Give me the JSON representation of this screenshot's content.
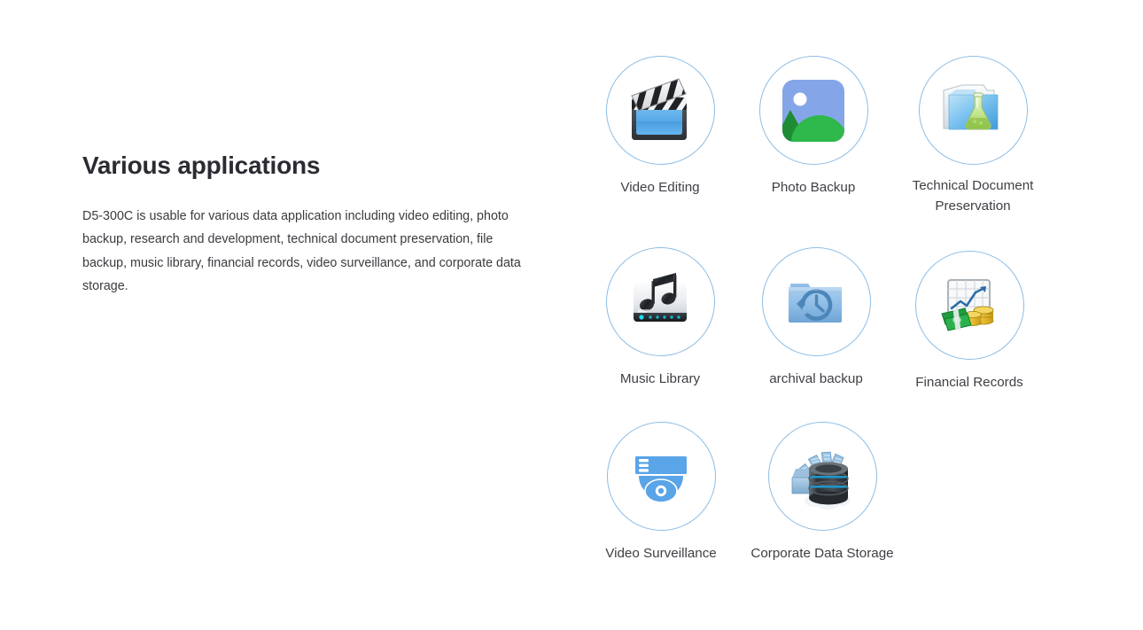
{
  "text_panel": {
    "title": "Various applications",
    "description": "D5-300C is usable for various data application including video editing, photo backup, research and development, technical document preservation, file backup, music library, financial records, video surveillance, and corporate data storage."
  },
  "colors": {
    "circle_border": "#8cbde5",
    "heading": "#2b2b33",
    "body_text": "#3a3a40",
    "label_text": "#3f3f45",
    "background": "#ffffff",
    "accent_blue": "#5aa9e6",
    "accent_green": "#2aab4a",
    "accent_gold": "#e8c234"
  },
  "icon_grid": {
    "items": [
      {
        "label": "Video Editing",
        "icon": "clapperboard-icon"
      },
      {
        "label": "Photo Backup",
        "icon": "photo-landscape-icon"
      },
      {
        "label": "Technical Document\nPreservation",
        "icon": "folder-flask-icon"
      },
      {
        "label": "Music Library",
        "icon": "music-drive-icon"
      },
      {
        "label": "archival backup",
        "icon": "folder-clock-icon"
      },
      {
        "label": "Financial Records",
        "icon": "chart-money-icon"
      },
      {
        "label": "Video Surveillance",
        "icon": "dome-camera-icon"
      },
      {
        "label": "Corporate Data Storage",
        "icon": "database-cloud-icon"
      }
    ]
  }
}
